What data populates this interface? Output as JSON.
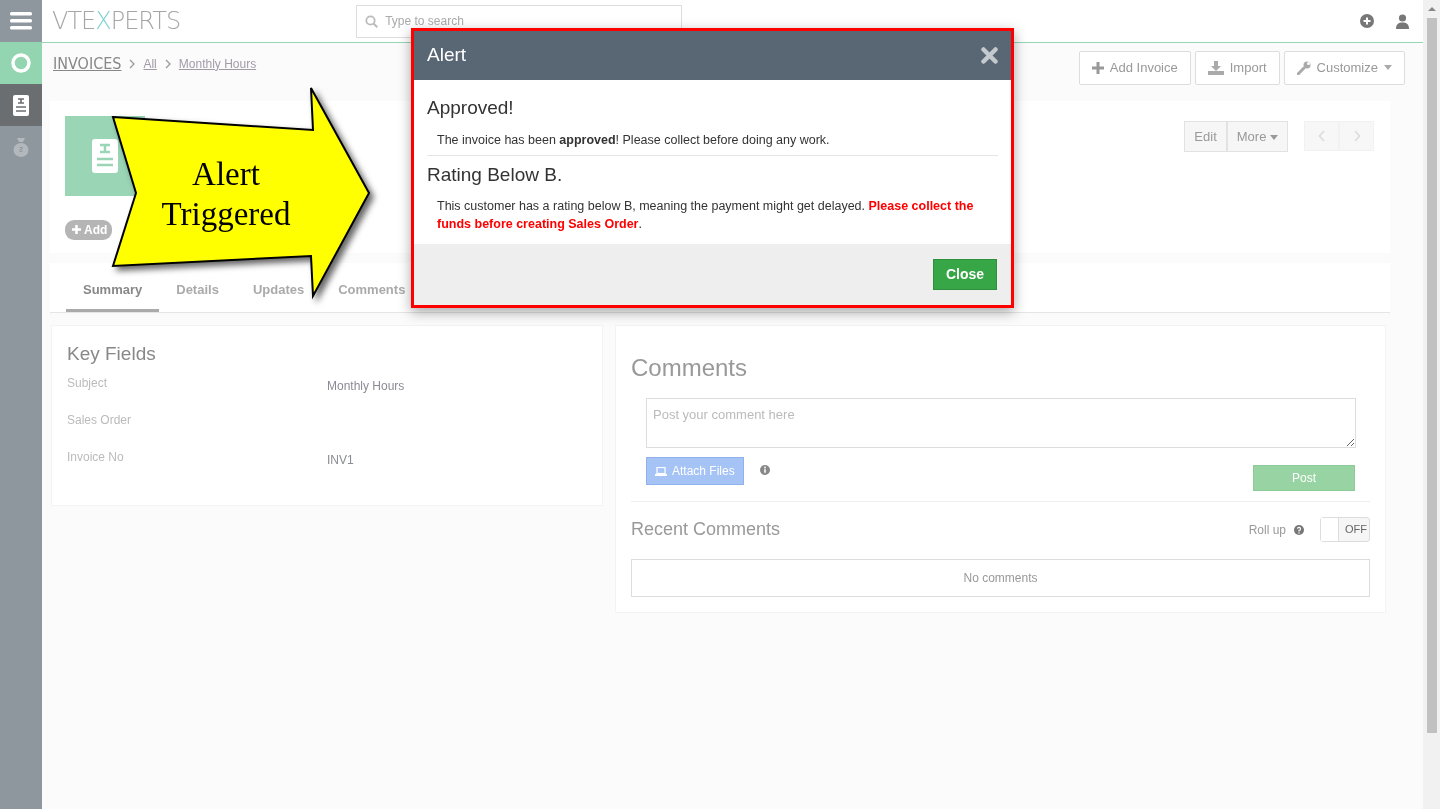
{
  "sidebar": {
    "items": [
      {
        "kind": "target",
        "selected": false
      },
      {
        "kind": "invoice",
        "selected": true
      },
      {
        "kind": "money",
        "selected": false
      }
    ]
  },
  "top_bar": {
    "logo": [
      {
        "text": "VTE",
        "accent": false
      },
      {
        "text": "X",
        "accent": true
      },
      {
        "text": "PERTS",
        "accent": false
      }
    ],
    "search": {
      "placeholder": "Type to search"
    }
  },
  "breadcrumb": [
    "INVOICES",
    "All",
    "Monthly Hours"
  ],
  "header_buttons": [
    {
      "label": "Add Invoice",
      "kind": "add"
    },
    {
      "label": "Import",
      "kind": "import"
    },
    {
      "label": "Customize",
      "kind": "customize"
    }
  ],
  "record": {
    "tag": "Add",
    "actions": [
      "Edit",
      "More"
    ]
  },
  "tabs": [
    {
      "label": "Summary",
      "selected": true
    },
    {
      "label": "Details",
      "selected": false
    },
    {
      "label": "Updates",
      "selected": false
    },
    {
      "label": "Comments",
      "selected": false
    }
  ],
  "key_fields": {
    "title": "Key Fields",
    "fields": [
      {
        "label": "Subject",
        "value": "Monthly Hours"
      },
      {
        "label": "Sales Order"
      },
      {
        "label": "Invoice No",
        "value": "INV1"
      }
    ]
  },
  "comments": {
    "title": "Comments",
    "placeholder": "Post your comment here",
    "attach": "Attach Files",
    "post": "Post",
    "recent_title": "Recent Comments",
    "rollup": "Roll up",
    "toggle": {
      "on": false,
      "label": "OFF"
    },
    "empty": "No comments"
  },
  "alert": {
    "title": "Alert",
    "sections": [
      {
        "heading": "Approved!",
        "body": [
          {
            "kind": "plain",
            "text": "The invoice has been "
          },
          {
            "kind": "bold",
            "text": "approved"
          },
          {
            "kind": "plain",
            "text": "! Please collect before doing any work."
          }
        ]
      },
      {
        "heading": "Rating Below B.",
        "body": [
          {
            "kind": "plain",
            "text": "This customer has a rating below B, meaning the payment might get delayed. "
          },
          {
            "kind": "warning",
            "text": "Please collect the funds before creating Sales Order"
          },
          {
            "kind": "plain",
            "text": "."
          }
        ]
      }
    ],
    "close": "Close"
  },
  "callout": {
    "text": "Alert Triggered"
  }
}
